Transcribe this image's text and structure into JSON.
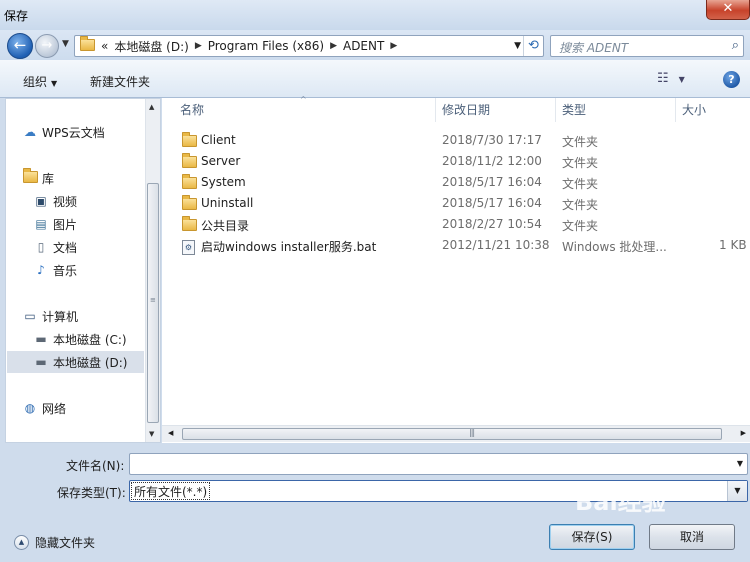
{
  "window": {
    "title": "保存",
    "close_glyph": "✕"
  },
  "nav": {
    "breadcrumb_prefix": "«",
    "breadcrumbs": [
      "本地磁盘 (D:)",
      "Program Files (x86)",
      "ADENT"
    ],
    "search_placeholder": "搜索 ADENT"
  },
  "toolbar": {
    "organize_label": "组织",
    "new_folder_label": "新建文件夹"
  },
  "sidebar": {
    "items": [
      {
        "label": "WPS云文档",
        "icon": "cloud-icon"
      },
      {
        "label": "库",
        "icon": "library-icon"
      },
      {
        "label": "视频",
        "icon": "video-icon"
      },
      {
        "label": "图片",
        "icon": "picture-icon"
      },
      {
        "label": "文档",
        "icon": "document-icon"
      },
      {
        "label": "音乐",
        "icon": "music-icon"
      },
      {
        "label": "计算机",
        "icon": "computer-icon"
      },
      {
        "label": "本地磁盘 (C:)",
        "icon": "drive-icon"
      },
      {
        "label": "本地磁盘 (D:)",
        "icon": "drive-icon",
        "selected": true
      },
      {
        "label": "网络",
        "icon": "network-icon"
      }
    ]
  },
  "columns": {
    "name": "名称",
    "date": "修改日期",
    "type": "类型",
    "size": "大小"
  },
  "files": [
    {
      "name": "Client",
      "date": "2018/7/30 17:17",
      "type": "文件夹",
      "size": "",
      "icon": "folder-icon"
    },
    {
      "name": "Server",
      "date": "2018/11/2 12:00",
      "type": "文件夹",
      "size": "",
      "icon": "folder-icon"
    },
    {
      "name": "System",
      "date": "2018/5/17 16:04",
      "type": "文件夹",
      "size": "",
      "icon": "folder-icon"
    },
    {
      "name": "Uninstall",
      "date": "2018/5/17 16:04",
      "type": "文件夹",
      "size": "",
      "icon": "folder-icon"
    },
    {
      "name": "公共目录",
      "date": "2018/2/27 10:54",
      "type": "文件夹",
      "size": "",
      "icon": "folder-icon"
    },
    {
      "name": "启动windows installer服务.bat",
      "date": "2012/11/21 10:38",
      "type": "Windows 批处理...",
      "size": "1 KB",
      "icon": "batch-file-icon"
    }
  ],
  "form": {
    "filename_label": "文件名(N):",
    "filename_value": "",
    "filetype_label": "保存类型(T):",
    "filetype_value": "所有文件(*.*)"
  },
  "footer": {
    "hide_folders_label": "隐藏文件夹",
    "save_label": "保存(S)",
    "cancel_label": "取消",
    "watermark": "Bai经验"
  }
}
